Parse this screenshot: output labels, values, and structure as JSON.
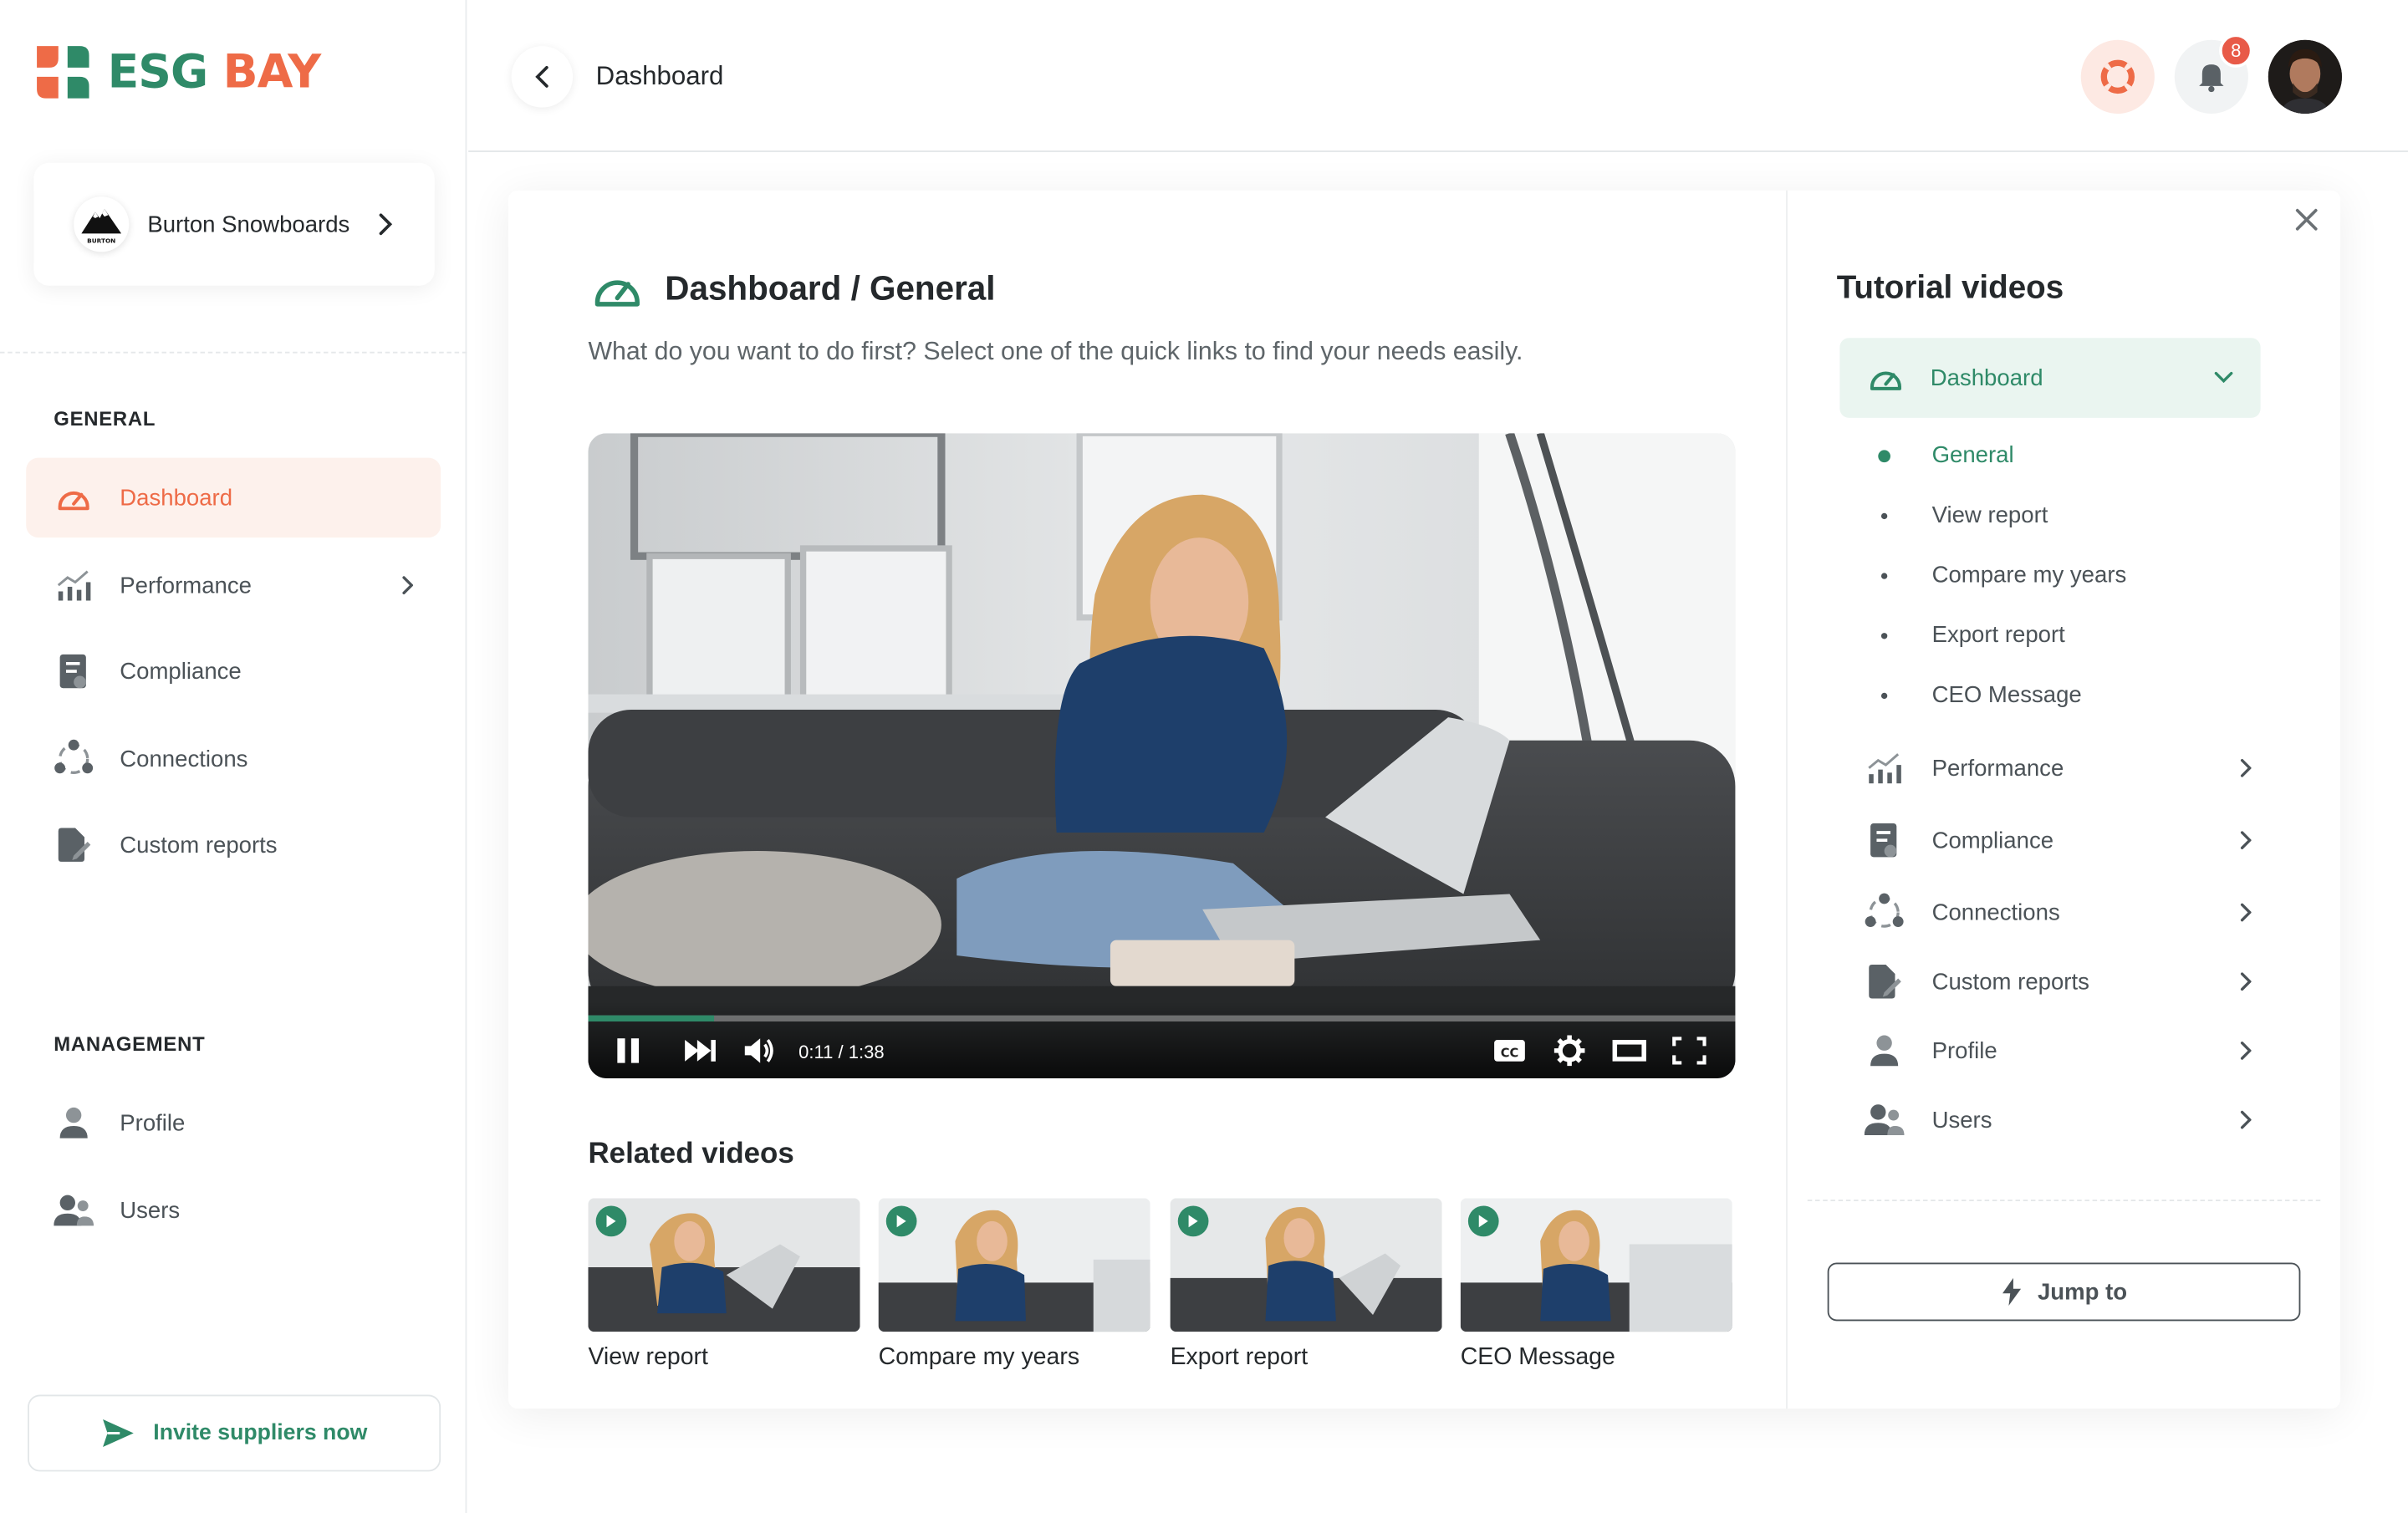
{
  "brand": {
    "word1": "ESG",
    "word2": "BAY"
  },
  "company": {
    "name": "Burton Snowboards",
    "logo_text": "BURTON"
  },
  "sidebar": {
    "general_title": "GENERAL",
    "management_title": "MANAGEMENT",
    "items": [
      {
        "label": "Dashboard",
        "icon": "speedometer-icon",
        "active": true
      },
      {
        "label": "Performance",
        "icon": "bar-chart-icon",
        "has_chevron": true
      },
      {
        "label": "Compliance",
        "icon": "document-check-icon"
      },
      {
        "label": "Connections",
        "icon": "connections-icon"
      },
      {
        "label": "Custom reports",
        "icon": "custom-report-icon"
      }
    ],
    "management_items": [
      {
        "label": "Profile",
        "icon": "user-icon"
      },
      {
        "label": "Users",
        "icon": "users-icon"
      }
    ],
    "invite_label": "Invite suppliers now"
  },
  "header": {
    "title": "Dashboard",
    "notification_count": "8"
  },
  "main": {
    "heading": "Dashboard / General",
    "subtitle": "What do you want to do first? Select one of the quick links to find your needs easily.",
    "video": {
      "time": "0:11 / 1:38",
      "progress": 0.11,
      "cc_label": "CC"
    },
    "related_title": "Related videos",
    "related": [
      {
        "label": "View report"
      },
      {
        "label": "Compare my years"
      },
      {
        "label": "Export report"
      },
      {
        "label": "CEO Message"
      }
    ]
  },
  "tutorials": {
    "title": "Tutorial videos",
    "active_section": "Dashboard",
    "sub_items": [
      "General",
      "View report",
      "Compare my years",
      "Export report",
      "CEO Message"
    ],
    "sections": [
      "Performance",
      "Compliance",
      "Connections",
      "Custom reports",
      "Profile",
      "Users"
    ],
    "jump_label": "Jump to"
  },
  "colors": {
    "brand_green": "#2f8a68",
    "brand_orange": "#ee6b47",
    "badge_red": "#e85a48"
  }
}
